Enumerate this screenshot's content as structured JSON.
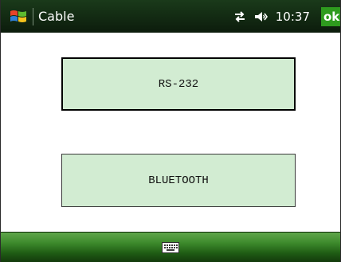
{
  "titlebar": {
    "title": "Cable",
    "clock": "10:37",
    "ok_label": "ok",
    "start_icon": "windows-flag-icon",
    "connectivity_icon": "connectivity-arrows-icon",
    "volume_icon": "speaker-icon"
  },
  "content": {
    "buttons": [
      {
        "label": "RS-232",
        "selected": true
      },
      {
        "label": "BLUETOOTH",
        "selected": false
      }
    ]
  },
  "menubar": {
    "input_icon": "keyboard-icon"
  },
  "colors": {
    "titlebar": "#0c1c0c",
    "ok_button": "#2e9b1e",
    "choice_fill": "#d2ecd2",
    "menubar": "#3d8a2c"
  }
}
